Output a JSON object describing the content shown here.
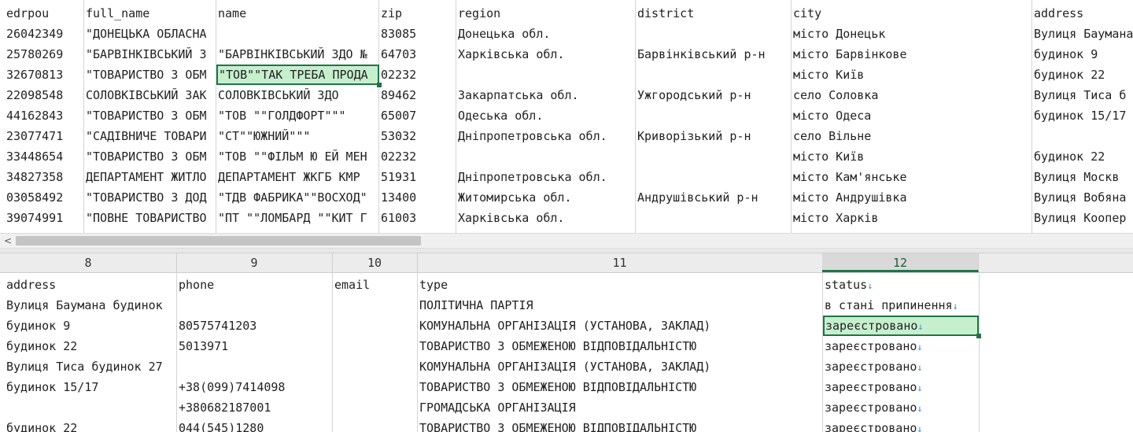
{
  "top": {
    "headers": [
      "edrpou",
      "full_name",
      "name",
      "zip",
      "region",
      "district",
      "city",
      "address"
    ],
    "rows": [
      [
        "26042349",
        "\"ДОНЕЦЬКА ОБЛАСНА",
        "",
        "83085",
        "Донецька обл.",
        "",
        "місто Донецьк",
        "Вулиця Баумана"
      ],
      [
        "25780269",
        "\"БАРВІНКІВСЬКИЙ З",
        "\"БАРВІНКІВСЬКИЙ ЗДО №",
        "64703",
        "Харківська обл.",
        "Барвінківський р-н",
        "місто Барвінкове",
        "будинок 9"
      ],
      [
        "32670813",
        "\"ТОВАРИСТВО З ОБМ",
        "\"ТОВ\"\"ТАК ТРЕБА ПРОДА",
        "02232",
        "",
        "",
        "місто Київ",
        "будинок 22"
      ],
      [
        "22098548",
        "СОЛОВКІВСЬКИЙ ЗАК",
        "СОЛОВКІВСЬКИЙ ЗДО",
        "89462",
        "Закарпатська обл.",
        "Ужгородський р-н",
        "село Соловка",
        "Вулиця Тиса б"
      ],
      [
        "44162843",
        "\"ТОВАРИСТВО З ОБМ",
        "\"ТОВ \"\"ГОЛДФОРТ\"\"\"",
        "65007",
        "Одеська обл.",
        "",
        "місто Одеса",
        "будинок 15/17"
      ],
      [
        "23077471",
        "\"САДІВНИЧЕ ТОВАРИ",
        "\"СТ\"\"ЮЖНИЙ\"\"\"",
        "53032",
        "Дніпропетровська обл.",
        "Криворізький р-н",
        "село Вільне",
        ""
      ],
      [
        "33448654",
        "\"ТОВАРИСТВО З ОБМ",
        "\"ТОВ \"\"ФІЛЬМ Ю ЕЙ МЕН",
        "02232",
        "",
        "",
        "місто Київ",
        "будинок 22"
      ],
      [
        "34827358",
        "ДЕПАРТАМЕНТ ЖИТЛО",
        "ДЕПАРТАМЕНТ ЖКГБ КМР",
        "51931",
        "Дніпропетровська обл.",
        "",
        "місто Кам'янське",
        "Вулиця  Москв"
      ],
      [
        "03058492",
        "\"ТОВАРИСТВО З ДОД",
        "\"ТДВ ФАБРИКА\"\"ВОСХОД\"",
        "13400",
        "Житомирська обл.",
        "Андрушівський р-н",
        "місто Андрушівка",
        "Вулиця Вобяна"
      ],
      [
        "39074991",
        "\"ПОВНЕ ТОВАРИСТВО",
        "\"ПТ \"\"ЛОМБАРД \"\"КИТ Г",
        "61003",
        "Харківська обл.",
        "",
        "місто Харків",
        "Вулиця Коопер"
      ]
    ]
  },
  "scrollbar": {
    "left_arrow": "<"
  },
  "bottom": {
    "column_numbers": [
      "8",
      "9",
      "10",
      "11",
      "12"
    ],
    "headers": [
      "address",
      "phone",
      "email",
      "type",
      "status"
    ],
    "rows": [
      [
        "Вулиця Баумана будинок",
        "",
        "",
        "ПОЛІТИЧНА ПАРТІЯ",
        "в стані припинення"
      ],
      [
        "будинок 9",
        "80575741203",
        "",
        "КОМУНАЛЬНА ОРГАНІЗАЦІЯ (УСТАНОВА, ЗАКЛАД)",
        "зареєстровано"
      ],
      [
        "будинок 22",
        "5013971",
        "",
        "ТОВАРИСТВО З ОБМЕЖЕНОЮ ВІДПОВІДАЛЬНІСТЮ",
        "зареєстровано"
      ],
      [
        "Вулиця Тиса будинок 27",
        "",
        "",
        "КОМУНАЛЬНА ОРГАНІЗАЦІЯ (УСТАНОВА, ЗАКЛАД)",
        "зареєстровано"
      ],
      [
        "будинок 15/17",
        "+38(099)7414098",
        "",
        "ТОВАРИСТВО З ОБМЕЖЕНОЮ ВІДПОВІДАЛЬНІСТЮ",
        "зареєстровано"
      ],
      [
        "",
        "+380682187001",
        "",
        "ГРОМАДСЬКА ОРГАНІЗАЦІЯ",
        "зареєстровано"
      ],
      [
        "будинок 22",
        "044(545)1280",
        "",
        "ТОВАРИСТВО З ОБМЕЖЕНОЮ ВІДПОВІДАЛЬНІСТЮ",
        "зареєстровано"
      ]
    ],
    "filter_glyph": "↓"
  },
  "colors": {
    "selection_fill": "#c6efce",
    "selection_border": "#217346",
    "filter_mark": "#3a8de0"
  }
}
